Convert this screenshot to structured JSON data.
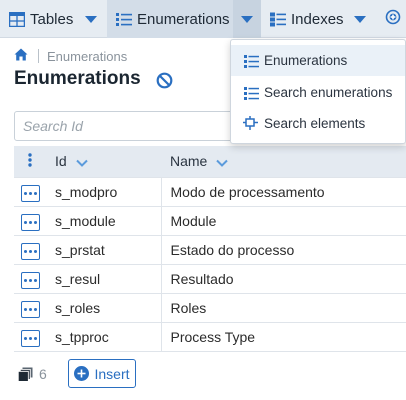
{
  "tabs": [
    {
      "label": "Tables",
      "icon": "table-grid-icon"
    },
    {
      "label": "Enumerations",
      "icon": "list-icon"
    },
    {
      "label": "Indexes",
      "icon": "index-list-icon"
    }
  ],
  "breadcrumb": {
    "current": "Enumerations"
  },
  "page": {
    "title": "Enumerations"
  },
  "search": {
    "placeholder": "Search Id"
  },
  "table": {
    "columns": [
      "Id",
      "Name"
    ],
    "rows": [
      {
        "id": "s_modpro",
        "name": "Modo de processamento"
      },
      {
        "id": "s_module",
        "name": "Module"
      },
      {
        "id": "s_prstat",
        "name": "Estado do processo"
      },
      {
        "id": "s_resul",
        "name": "Resultado"
      },
      {
        "id": "s_roles",
        "name": "Roles"
      },
      {
        "id": "s_tpproc",
        "name": "Process Type"
      }
    ]
  },
  "footer": {
    "count": "6",
    "insert_label": "Insert"
  },
  "dropdown": {
    "items": [
      "Enumerations",
      "Search enumerations",
      "Search elements"
    ]
  },
  "colors": {
    "accent": "#2a6fc1",
    "topbar_bg": "#e6ecf2",
    "active_tab_bg": "#d3dde8",
    "header_row_bg": "#e4eaf1",
    "highlight_item_bg": "#eaf1f8"
  }
}
